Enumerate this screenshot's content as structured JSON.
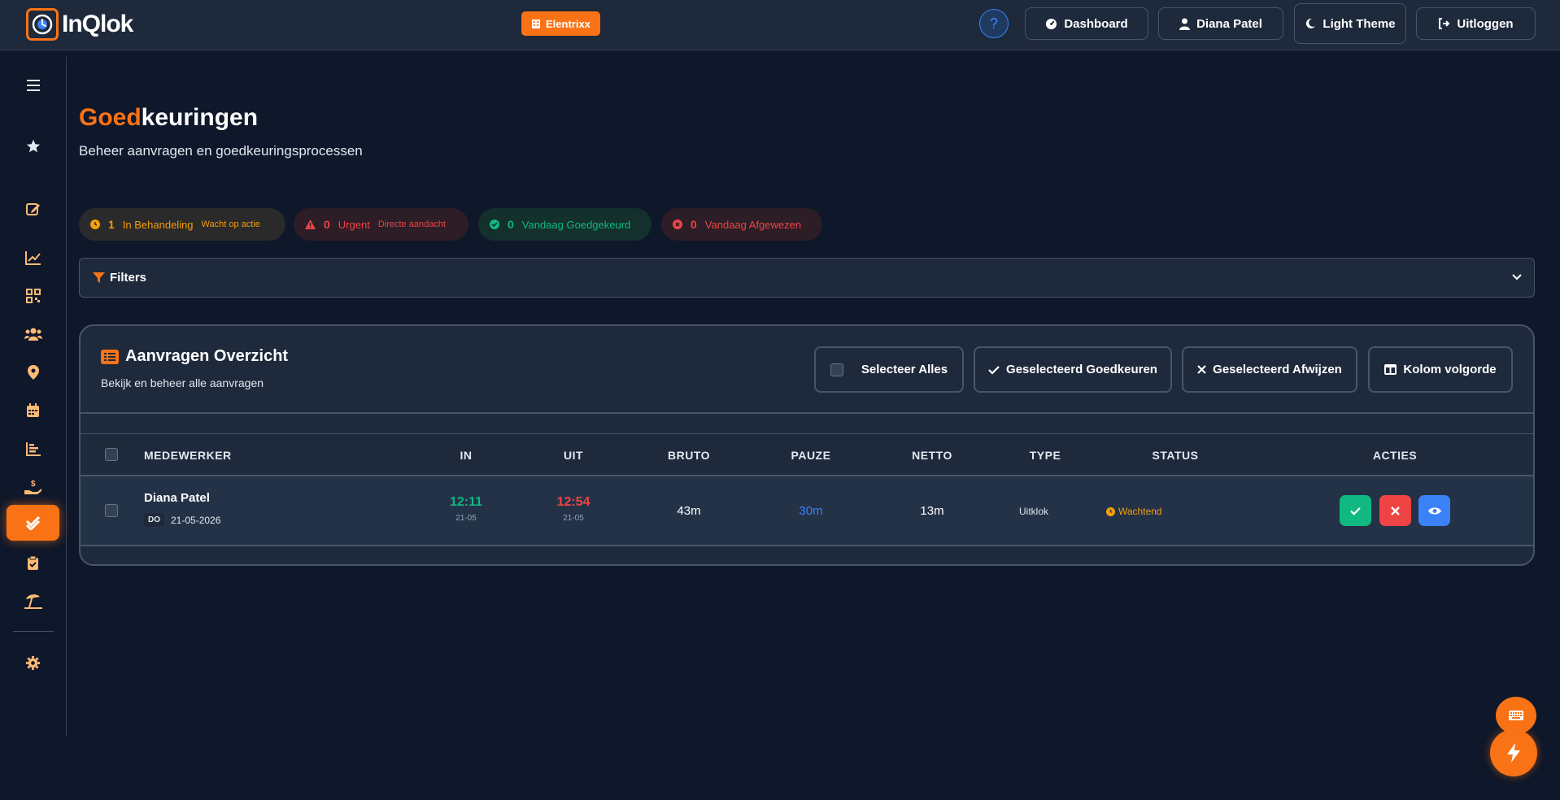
{
  "app": {
    "logo_text": "InQlok",
    "company": "Elentrixx"
  },
  "topbar": {
    "help": "?",
    "dashboard": "Dashboard",
    "user": "Diana Patel",
    "theme": "Light Theme",
    "logout": "Uitloggen"
  },
  "page": {
    "title_accent": "Goed",
    "title_rest": "keuringen",
    "subtitle": "Beheer aanvragen en goedkeuringsprocessen"
  },
  "stats": [
    {
      "count": "1",
      "label": "In Behandeling",
      "sub": "Wacht op actie",
      "color": "#f59e0b"
    },
    {
      "count": "0",
      "label": "Urgent",
      "sub": "Directe aandacht",
      "color": "#ef4444"
    },
    {
      "count": "0",
      "label": "Vandaag Goedgekeurd",
      "sub": "",
      "color": "#10b981"
    },
    {
      "count": "0",
      "label": "Vandaag Afgewezen",
      "sub": "",
      "color": "#ef4444"
    }
  ],
  "filters": {
    "label": "Filters"
  },
  "panel": {
    "title": "Aanvragen Overzicht",
    "subtitle": "Bekijk en beheer alle aanvragen",
    "select_all": "Selecteer Alles",
    "approve_selected": "Geselecteerd Goedkeuren",
    "reject_selected": "Geselecteerd Afwijzen",
    "column_order": "Kolom volgorde"
  },
  "table": {
    "headers": {
      "employee": "MEDEWERKER",
      "in": "IN",
      "out": "UIT",
      "gross": "BRUTO",
      "pause": "PAUZE",
      "net": "NETTO",
      "type": "TYPE",
      "status": "STATUS",
      "actions": "ACTIES"
    },
    "rows": [
      {
        "name": "Diana Patel",
        "day": "DO",
        "date": "21-05-2026",
        "in_time": "12:11",
        "in_date": "21-05",
        "out_time": "12:54",
        "out_date": "21-05",
        "gross": "43m",
        "pause": "30m",
        "net": "13m",
        "type": "Uitklok",
        "status": "Wachtend"
      }
    ]
  },
  "colors": {
    "accent": "#f97316",
    "approve": "#10b981",
    "reject": "#ef4444",
    "view": "#3b82f6",
    "pending": "#f59e0b"
  },
  "icons": {
    "sidebar": [
      "menu-icon",
      "star-icon",
      "edit-icon",
      "chart-line-icon",
      "qrcode-icon",
      "users-icon",
      "location-icon",
      "calendar-icon",
      "bar-chart-icon",
      "payment-icon",
      "approvals-icon",
      "clipboard-icon",
      "beach-icon",
      "settings-icon"
    ]
  }
}
